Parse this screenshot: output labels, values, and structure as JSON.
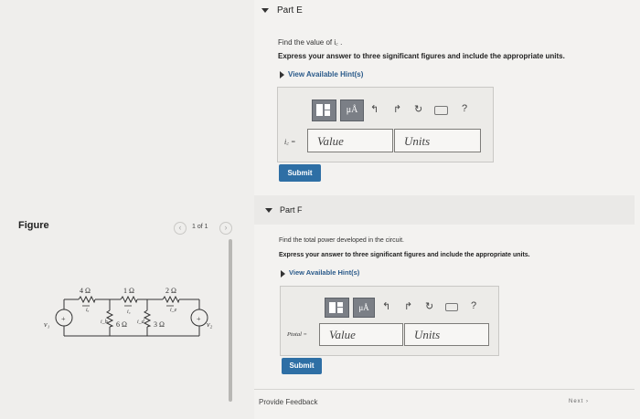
{
  "part_e": {
    "title": "Part E",
    "question": "Find the value of i꜀ .",
    "instruction": "Express your answer to three significant figures and include the appropriate units.",
    "hint_link": "View Available Hint(s)",
    "variable_label": "i꜀ =",
    "value_placeholder": "Value",
    "units_placeholder": "Units",
    "submit_label": "Submit"
  },
  "part_f": {
    "title": "Part F",
    "question": "Find the total power developed in the circuit.",
    "instruction": "Express your answer to three significant figures and include the appropriate units.",
    "hint_link": "View Available Hint(s)",
    "variable_label": "Ptotal =",
    "value_placeholder": "Value",
    "units_placeholder": "Units",
    "submit_label": "Submit"
  },
  "toolbar": {
    "mu_label": "μÅ",
    "help_label": "?"
  },
  "figure": {
    "title": "Figure",
    "pager": "1 of 1",
    "resistors": [
      "4 Ω",
      "1 Ω",
      "2 Ω",
      "6 Ω",
      "3 Ω"
    ],
    "sources": [
      "v₁",
      "v₂"
    ],
    "currents": [
      "iₐ",
      "i_b",
      "i꜀",
      "i_d",
      "i_e"
    ]
  },
  "footer": {
    "feedback_link": "Provide Feedback",
    "next_label": "Next ›"
  },
  "colors": {
    "submit_bg": "#2e6fa5",
    "hint_link": "#2a5a8a"
  }
}
